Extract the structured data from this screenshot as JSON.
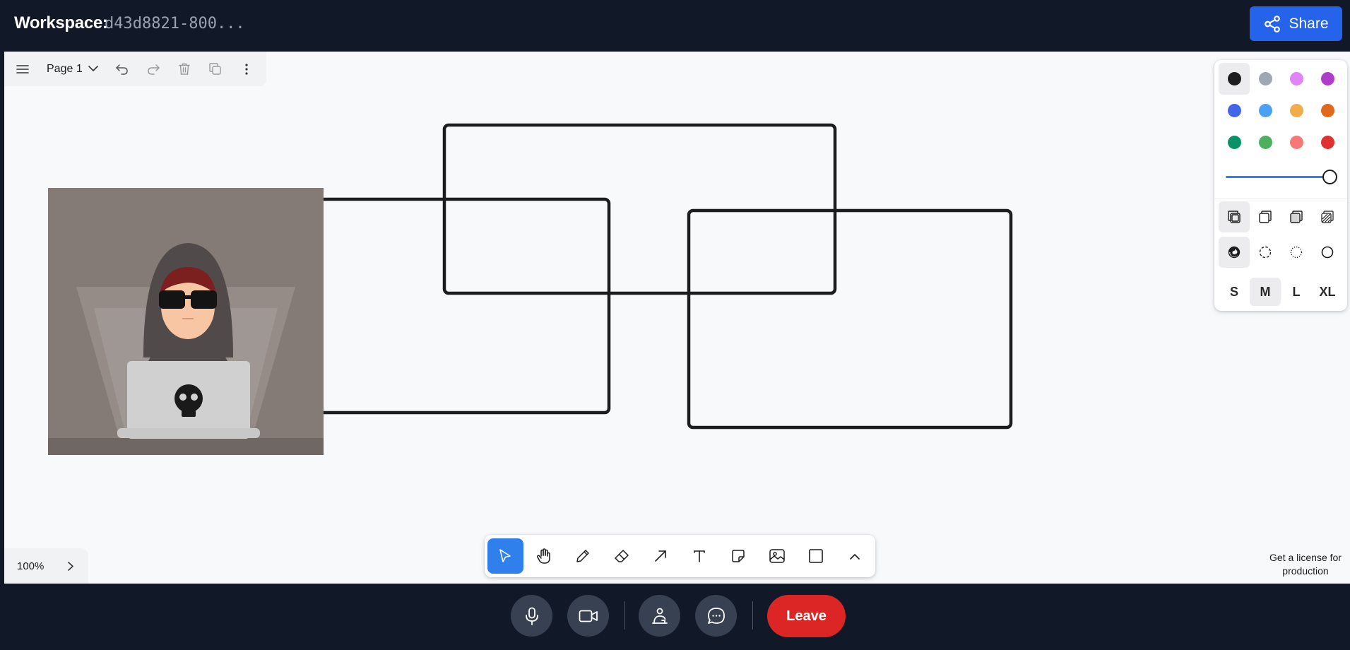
{
  "header": {
    "title": "Workspace:",
    "workspace_id": "d43d8821-800...",
    "share_label": "Share"
  },
  "topbar": {
    "page_label": "Page 1",
    "icons": [
      "menu-icon",
      "chevron-down-icon",
      "undo-icon",
      "redo-icon",
      "trash-icon",
      "duplicate-icon",
      "more-vertical-icon"
    ]
  },
  "style_panel": {
    "colors": [
      "#1d1d1d",
      "#9fa8b2",
      "#e085f4",
      "#ae3ec9",
      "#4465e9",
      "#4ba1f1",
      "#f1ac4b",
      "#e16919",
      "#099268",
      "#4cb05e",
      "#f87777",
      "#e03131"
    ],
    "selected_color": "#1d1d1d",
    "opacity": 1,
    "fill_options": [
      "fill-none-icon",
      "fill-semi-icon",
      "fill-solid-icon",
      "fill-pattern-icon"
    ],
    "dash_options": [
      "dash-draw-icon",
      "dash-dashed-icon",
      "dash-dotted-icon",
      "dash-solid-icon"
    ],
    "sizes": [
      "S",
      "M",
      "L",
      "XL"
    ],
    "selected_size": "M"
  },
  "zoom": {
    "level": "100%"
  },
  "toolbar": {
    "tools": [
      "select-tool",
      "hand-tool",
      "draw-tool",
      "eraser-tool",
      "arrow-tool",
      "text-tool",
      "note-tool",
      "image-tool",
      "rectangle-tool",
      "more-tools"
    ],
    "active_tool": "select-tool"
  },
  "license_text": "Get a license for production",
  "callbar": {
    "buttons": [
      "microphone-icon",
      "camera-icon",
      "share-presence-icon",
      "chat-icon"
    ],
    "leave_label": "Leave"
  }
}
